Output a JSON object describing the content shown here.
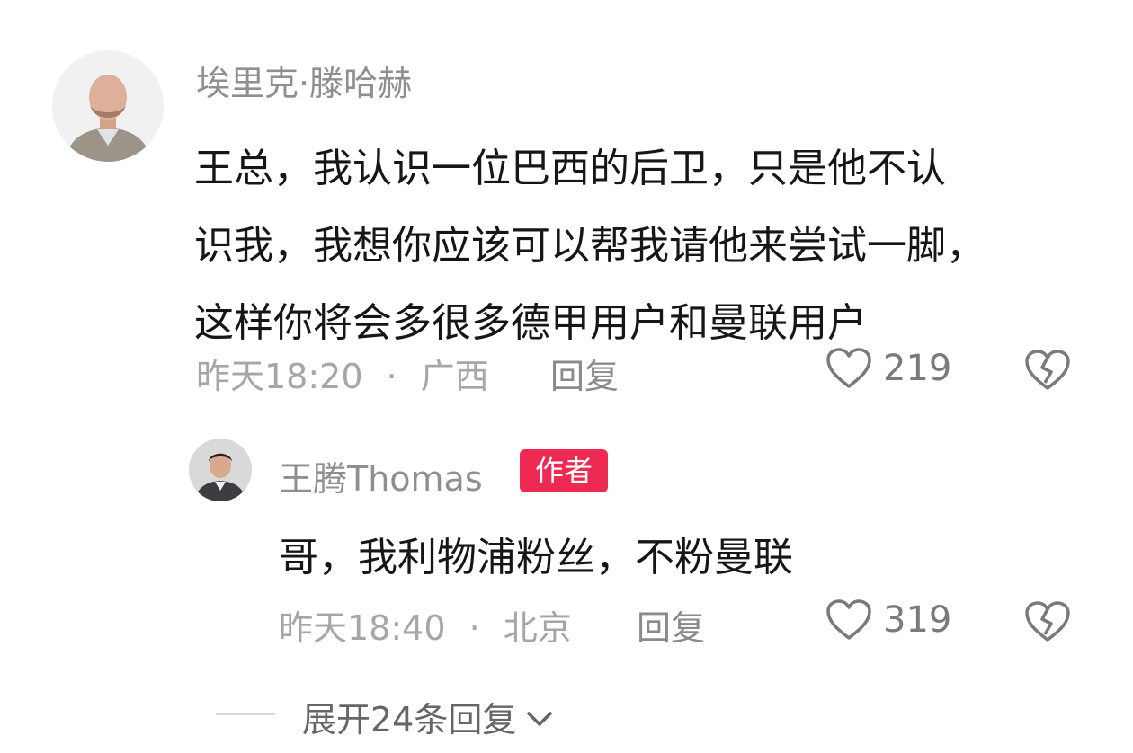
{
  "comment": {
    "username": "埃里克·滕哈赫",
    "content_lines": [
      "王总，我认识一位巴西的后卫，只是他不认",
      "识我，我想你应该可以帮我请他来尝试一脚，",
      "这样你将会多很多德甲用户和曼联用户"
    ],
    "time": "昨天18:20",
    "separator": "·",
    "location": "广西",
    "reply_label": "回复",
    "likes": "219"
  },
  "reply": {
    "username": "王腾Thomas",
    "badge": "作者",
    "content": "哥，我利物浦粉丝，不粉曼联",
    "time": "昨天18:40",
    "separator": "·",
    "location": "北京",
    "reply_label": "回复",
    "likes": "319"
  },
  "expand": {
    "label": "展开24条回复"
  },
  "icons": {
    "like": "heart-outline-icon",
    "dislike": "broken-heart-icon",
    "expand": "chevron-down-icon"
  },
  "colors": {
    "badge": "#ee2a53",
    "username": "#8f8f8f",
    "text": "#161616",
    "meta": "#a6a6a6"
  }
}
